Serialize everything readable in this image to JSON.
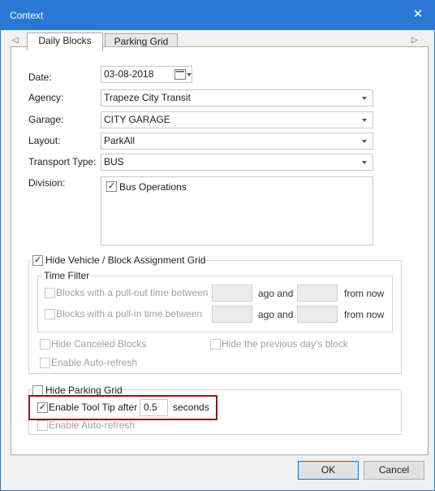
{
  "window": {
    "title": "Context",
    "close_glyph": "✕"
  },
  "tabs": [
    {
      "label": "Daily Blocks",
      "active": true
    },
    {
      "label": "Parking Grid",
      "active": false
    }
  ],
  "nav": {
    "left_arrow": "◁",
    "right_arrow": "▷"
  },
  "form": {
    "date_label": "Date:",
    "date_value": "03-08-2018",
    "agency_label": "Agency:",
    "agency_value": "Trapeze City Transit",
    "garage_label": "Garage:",
    "garage_value": "CITY GARAGE",
    "layout_label": "Layout:",
    "layout_value": "ParkAll",
    "transport_label": "Transport Type:",
    "transport_value": "BUS",
    "division_label": "Division:",
    "division_items": [
      {
        "label": "Bus Operations",
        "checked": true
      }
    ]
  },
  "vehicle_grid": {
    "hide_label": "Hide Vehicle / Block Assignment Grid",
    "hide_checked": true,
    "time_filter_label": "Time Filter",
    "pullout_label": "Blocks with a pull-out time between",
    "pullin_label": "Blocks with a pull-in time between",
    "ago_and": "ago and",
    "from_now": "from now",
    "hide_canceled_label": "Hide Canceled Blocks",
    "hide_prev_day_label": "Hide the previous day's block",
    "auto_refresh_label": "Enable Auto-refresh"
  },
  "parking_grid": {
    "hide_label": "Hide Parking Grid",
    "hide_checked": false,
    "tooltip_label": "Enable Tool Tip after",
    "tooltip_checked": true,
    "tooltip_value": "0.5",
    "seconds_label": "seconds",
    "auto_refresh_label": "Enable Auto-refresh"
  },
  "buttons": {
    "ok": "OK",
    "cancel": "Cancel"
  },
  "check_glyph": "✓",
  "colors": {
    "titlebar": "#2b78d4",
    "highlight": "#8b1a1a"
  }
}
